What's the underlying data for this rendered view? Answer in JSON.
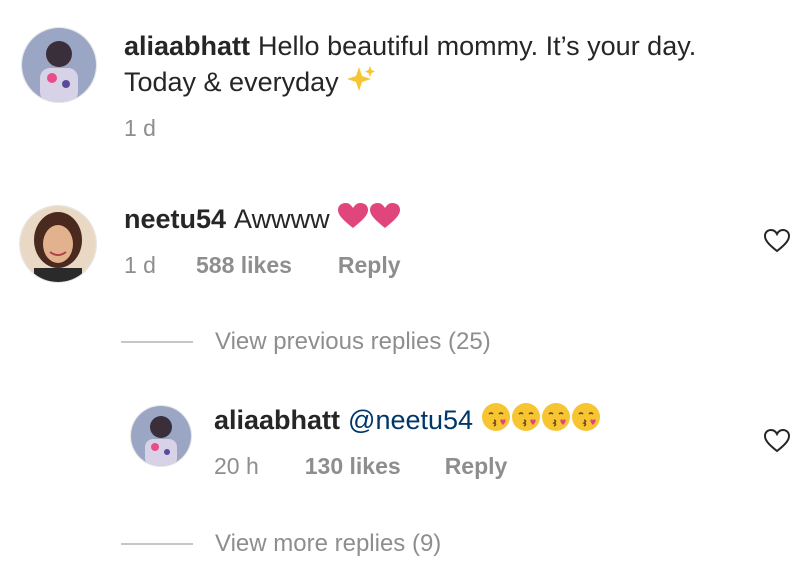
{
  "comments": [
    {
      "username": "aliaabhatt",
      "text_line1": "Hello beautiful mommy. It’s your day.",
      "text_line2": "Today & everyday",
      "time": "1 d"
    },
    {
      "username": "neetu54",
      "text": "Awwww",
      "time": "1 d",
      "likes": "588 likes",
      "reply": "Reply"
    }
  ],
  "view_previous": "View previous replies (25)",
  "reply_comment": {
    "username": "aliaabhatt",
    "mention": "@neetu54",
    "time": "20 h",
    "likes": "130 likes",
    "reply": "Reply"
  },
  "view_more": "View more replies (9)",
  "icons": {
    "sparkle": "sparkles-icon",
    "heart": "pink-heart-icon",
    "kiss": "kissing-face-icon",
    "like": "heart-outline-icon"
  },
  "colors": {
    "username": "#262626",
    "meta": "#8e8e8e",
    "pink_heart": "#e0457b",
    "emoji_yellow": "#f7c531"
  }
}
